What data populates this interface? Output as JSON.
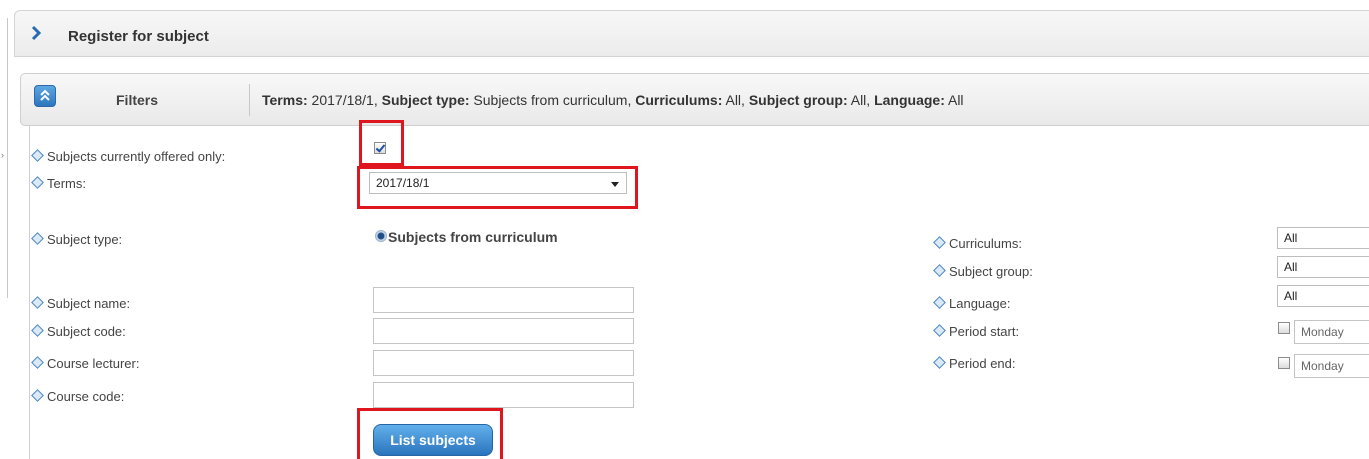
{
  "panel": {
    "title": "Register for subject"
  },
  "filters": {
    "label": "Filters",
    "summary": [
      {
        "key": "Terms:",
        "value": " 2017/18/1, "
      },
      {
        "key": "Subject type:",
        "value": " Subjects from curriculum, "
      },
      {
        "key": "Curriculums:",
        "value": " All, "
      },
      {
        "key": "Subject group:",
        "value": " All, "
      },
      {
        "key": "Language:",
        "value": " All"
      }
    ]
  },
  "form": {
    "offered_only_label": "Subjects currently offered only:",
    "offered_only_checked": true,
    "terms_label": "Terms:",
    "terms_value": "2017/18/1",
    "subject_type_label": "Subject type:",
    "subject_type_option": "Subjects from curriculum",
    "subject_name_label": "Subject name:",
    "subject_code_label": "Subject code:",
    "course_lecturer_label": "Course lecturer:",
    "course_code_label": "Course code:",
    "curriculums_label": "Curriculums:",
    "curriculums_value": "All",
    "subject_group_label": "Subject group:",
    "subject_group_value": "All",
    "language_label": "Language:",
    "language_value": "All",
    "period_start_label": "Period start:",
    "period_start_value": "Monday",
    "period_end_label": "Period end:",
    "period_end_value": "Monday",
    "list_button": "List subjects"
  },
  "colors": {
    "accent": "#2d76bd",
    "highlight": "#e0161e"
  },
  "icons": {
    "header": "chevron-right-icon",
    "collapse": "double-chevron-up-icon",
    "bullet": "diamond-bullet-icon"
  }
}
